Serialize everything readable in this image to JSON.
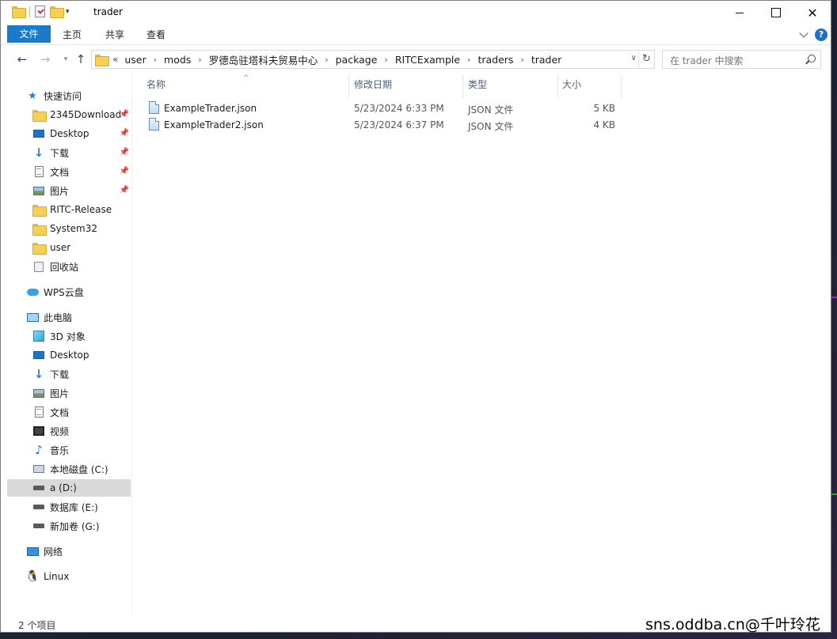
{
  "window": {
    "title": "trader"
  },
  "ribbon": {
    "tabs": [
      "文件",
      "主页",
      "共享",
      "查看"
    ],
    "help": "?"
  },
  "address": {
    "overflow": "«",
    "crumbs": [
      "user",
      "mods",
      "罗德岛驻塔科夫贸易中心",
      "package",
      "RITCExample",
      "traders",
      "trader"
    ]
  },
  "search": {
    "placeholder": "在 trader 中搜索"
  },
  "sidebar": {
    "quick_access": "快速访问",
    "quick_items": [
      {
        "label": "2345Download",
        "icon": "folder-icon",
        "pinned": true
      },
      {
        "label": "Desktop",
        "icon": "desktop-icon",
        "pinned": true
      },
      {
        "label": "下载",
        "icon": "download-icon",
        "pinned": true
      },
      {
        "label": "文档",
        "icon": "document-icon",
        "pinned": true
      },
      {
        "label": "图片",
        "icon": "pictures-icon",
        "pinned": true
      },
      {
        "label": "RITC-Release",
        "icon": "folder-icon",
        "pinned": false
      },
      {
        "label": "System32",
        "icon": "folder-icon",
        "pinned": false
      },
      {
        "label": "user",
        "icon": "folder-icon",
        "pinned": false
      },
      {
        "label": "回收站",
        "icon": "recycle-bin-icon",
        "pinned": false
      }
    ],
    "wps": "WPS云盘",
    "this_pc": "此电脑",
    "pc_items": [
      {
        "label": "3D 对象",
        "icon": "3d-objects-icon"
      },
      {
        "label": "Desktop",
        "icon": "desktop-icon"
      },
      {
        "label": "下载",
        "icon": "download-icon"
      },
      {
        "label": "图片",
        "icon": "pictures-icon"
      },
      {
        "label": "文档",
        "icon": "document-icon"
      },
      {
        "label": "视频",
        "icon": "video-icon"
      },
      {
        "label": "音乐",
        "icon": "music-icon"
      },
      {
        "label": "本地磁盘 (C:)",
        "icon": "drive-c-icon"
      },
      {
        "label": "a (D:)",
        "icon": "drive-icon",
        "selected": true
      },
      {
        "label": "数据库 (E:)",
        "icon": "drive-icon"
      },
      {
        "label": "新加卷 (G:)",
        "icon": "drive-icon"
      }
    ],
    "network": "网络",
    "linux": "Linux"
  },
  "columns": {
    "name": "名称",
    "date": "修改日期",
    "type": "类型",
    "size": "大小"
  },
  "files": [
    {
      "name": "ExampleTrader.json",
      "date": "5/23/2024 6:33 PM",
      "type": "JSON 文件",
      "size": "5 KB"
    },
    {
      "name": "ExampleTrader2.json",
      "date": "5/23/2024 6:37 PM",
      "type": "JSON 文件",
      "size": "4 KB"
    }
  ],
  "status": {
    "count": "2 个项目"
  },
  "watermark": "sns.oddba.cn@千叶玲花"
}
